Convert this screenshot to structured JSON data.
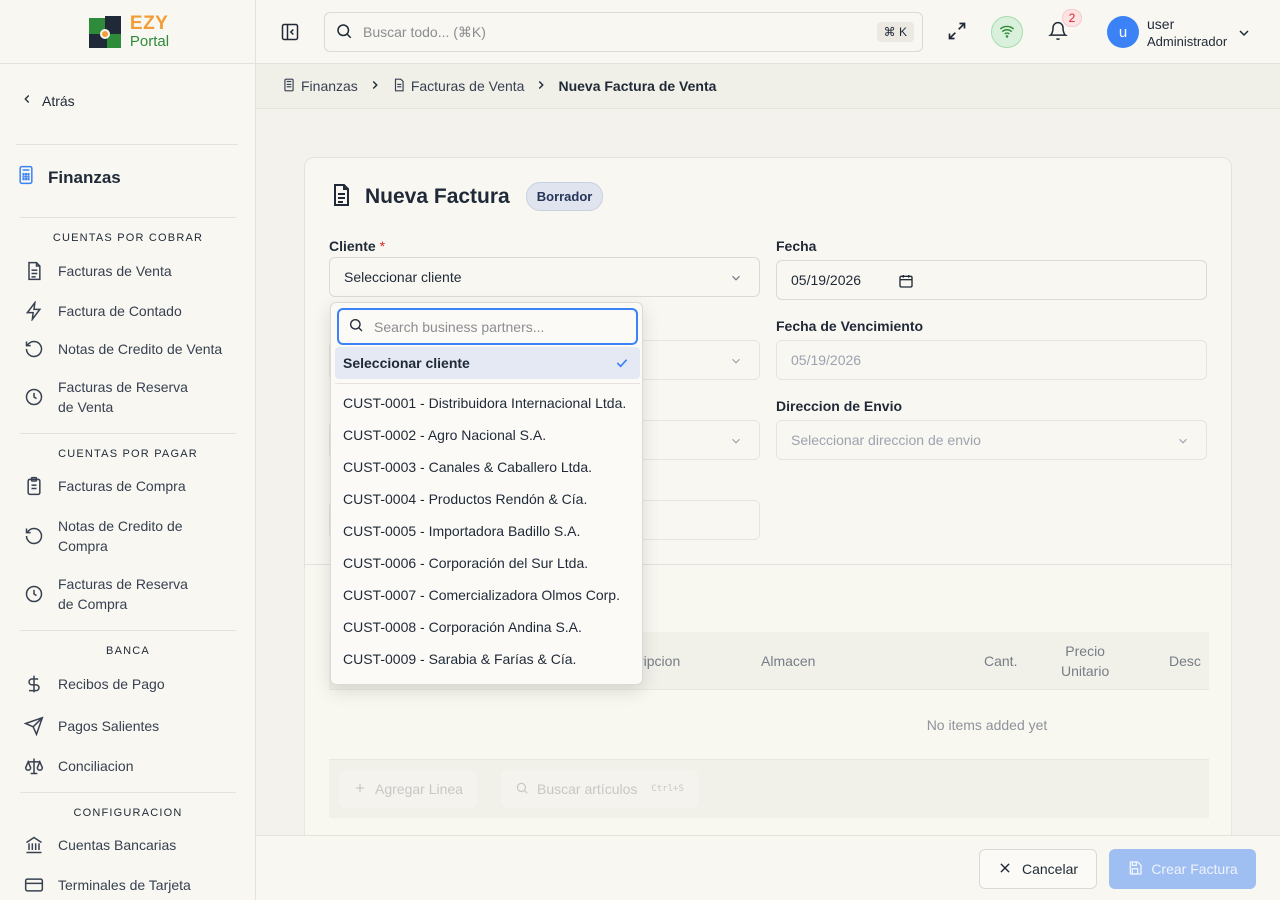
{
  "logo": {
    "line1": "EZY",
    "line2": "Portal"
  },
  "sidebar": {
    "back_label": "Atrás",
    "module_title": "Finanzas",
    "groups": [
      {
        "title": "CUENTAS POR COBRAR",
        "items": [
          {
            "label": "Facturas de Venta",
            "icon": "document-icon"
          },
          {
            "label": "Factura de Contado",
            "icon": "lightning-icon"
          },
          {
            "label": "Notas de Credito de Venta",
            "icon": "rotate-ccw-icon"
          },
          {
            "label": "Facturas de Reserva de Venta",
            "icon": "clock-icon"
          }
        ]
      },
      {
        "title": "CUENTAS POR PAGAR",
        "items": [
          {
            "label": "Facturas de Compra",
            "icon": "clipboard-icon"
          },
          {
            "label": "Notas de Credito de Compra",
            "icon": "rotate-ccw-icon"
          },
          {
            "label": "Facturas de Reserva de Compra",
            "icon": "clock-icon"
          }
        ]
      },
      {
        "title": "BANCA",
        "items": [
          {
            "label": "Recibos de Pago",
            "icon": "dollar-icon"
          },
          {
            "label": "Pagos Salientes",
            "icon": "send-icon"
          },
          {
            "label": "Conciliacion",
            "icon": "scale-icon"
          }
        ]
      },
      {
        "title": "CONFIGURACION",
        "items": [
          {
            "label": "Cuentas Bancarias",
            "icon": "bank-icon"
          },
          {
            "label": "Terminales de Tarjeta",
            "icon": "credit-card-icon"
          }
        ]
      }
    ]
  },
  "topbar": {
    "search_placeholder": "Buscar todo... (⌘K)",
    "search_shortcut": "⌘ K",
    "notification_count": "2",
    "user_initial": "u",
    "user_name": "user",
    "user_role": "Administrador"
  },
  "breadcrumb": [
    "Finanzas",
    "Facturas de Venta",
    "Nueva Factura de Venta"
  ],
  "form": {
    "title": "Nueva Factura",
    "status": "Borrador",
    "cliente_label": "Cliente",
    "required_mark": "*",
    "cliente_value": "Seleccionar cliente",
    "fecha_label": "Fecha",
    "fecha_value": "05/19/2026",
    "vencimiento_label": "Fecha de Vencimiento",
    "vencimiento_value": "05/19/2026",
    "envio_label": "Direccion de Envio",
    "envio_placeholder": "Seleccionar direccion de envio"
  },
  "lines_table": {
    "columns": [
      "ripcion",
      "Almacen",
      "Cant.",
      "Precio\nUnitario",
      "Desc"
    ],
    "empty_text": "No items added yet",
    "add_line_label": "Agregar Linea",
    "search_items_label": "Buscar artículos",
    "search_items_shortcut": "Ctrl+S"
  },
  "actions": {
    "cancel_label": "Cancelar",
    "create_label": "Crear Factura"
  },
  "customer_dropdown": {
    "search_placeholder": "Search business partners...",
    "selected_label": "Seleccionar cliente",
    "options": [
      "CUST-0001 - Distribuidora Internacional Ltda.",
      "CUST-0002 - Agro Nacional S.A.",
      "CUST-0003 - Canales & Caballero Ltda.",
      "CUST-0004 - Productos Rendón & Cía.",
      "CUST-0005 - Importadora Badillo S.A.",
      "CUST-0006 - Corporación del Sur Ltda.",
      "CUST-0007 - Comercializadora Olmos Corp.",
      "CUST-0008 - Corporación Andina S.A.",
      "CUST-0009 - Sarabia & Farías & Cía."
    ]
  },
  "colors": {
    "accent": "#3b82f6",
    "status_badge_bg": "#dfe4ee",
    "notification": "#dc2626",
    "online": "#2e8b3a"
  }
}
